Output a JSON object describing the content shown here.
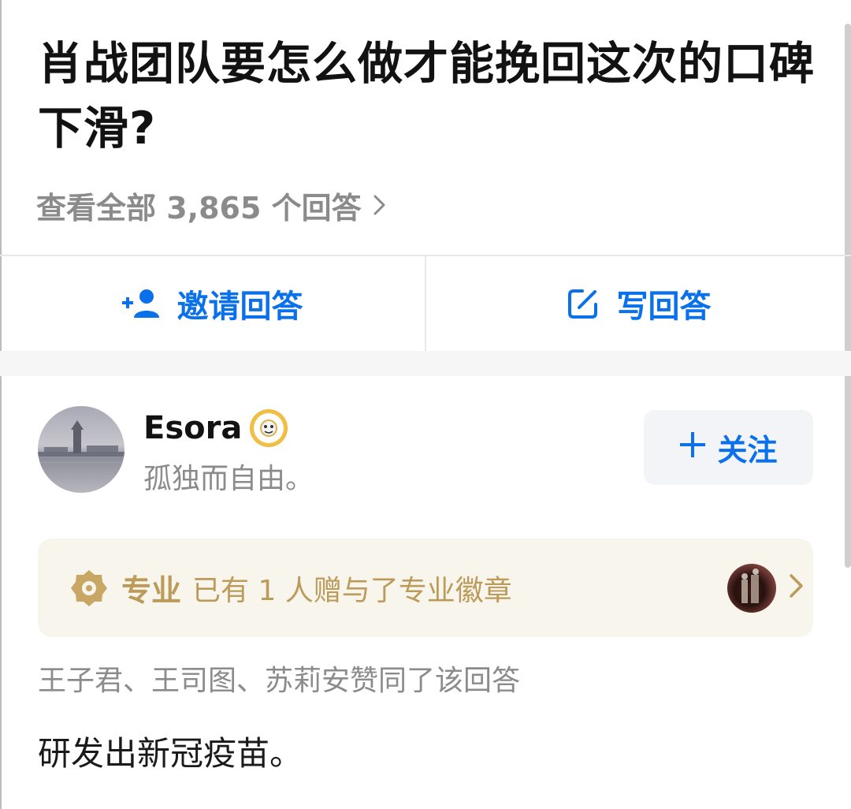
{
  "question": {
    "title": "肖战团队要怎么做才能挽回这次的口碑下滑?",
    "view_all": "查看全部 3,865 个回答"
  },
  "actions": {
    "invite_label": "邀请回答",
    "write_label": "写回答"
  },
  "author": {
    "name": "Esora",
    "bio": "孤独而自由。",
    "follow_label": "关注"
  },
  "pro_badge": {
    "label": "专业",
    "text": "已有 1 人赠与了专业徽章"
  },
  "likers": "王子君、王司图、苏莉安赞同了该回答",
  "answer": {
    "content": "研发出新冠疫苗。"
  },
  "colors": {
    "accent_blue": "#0a71ea",
    "gold": "#bc9b5a",
    "gray_text": "#8b8b8b"
  }
}
